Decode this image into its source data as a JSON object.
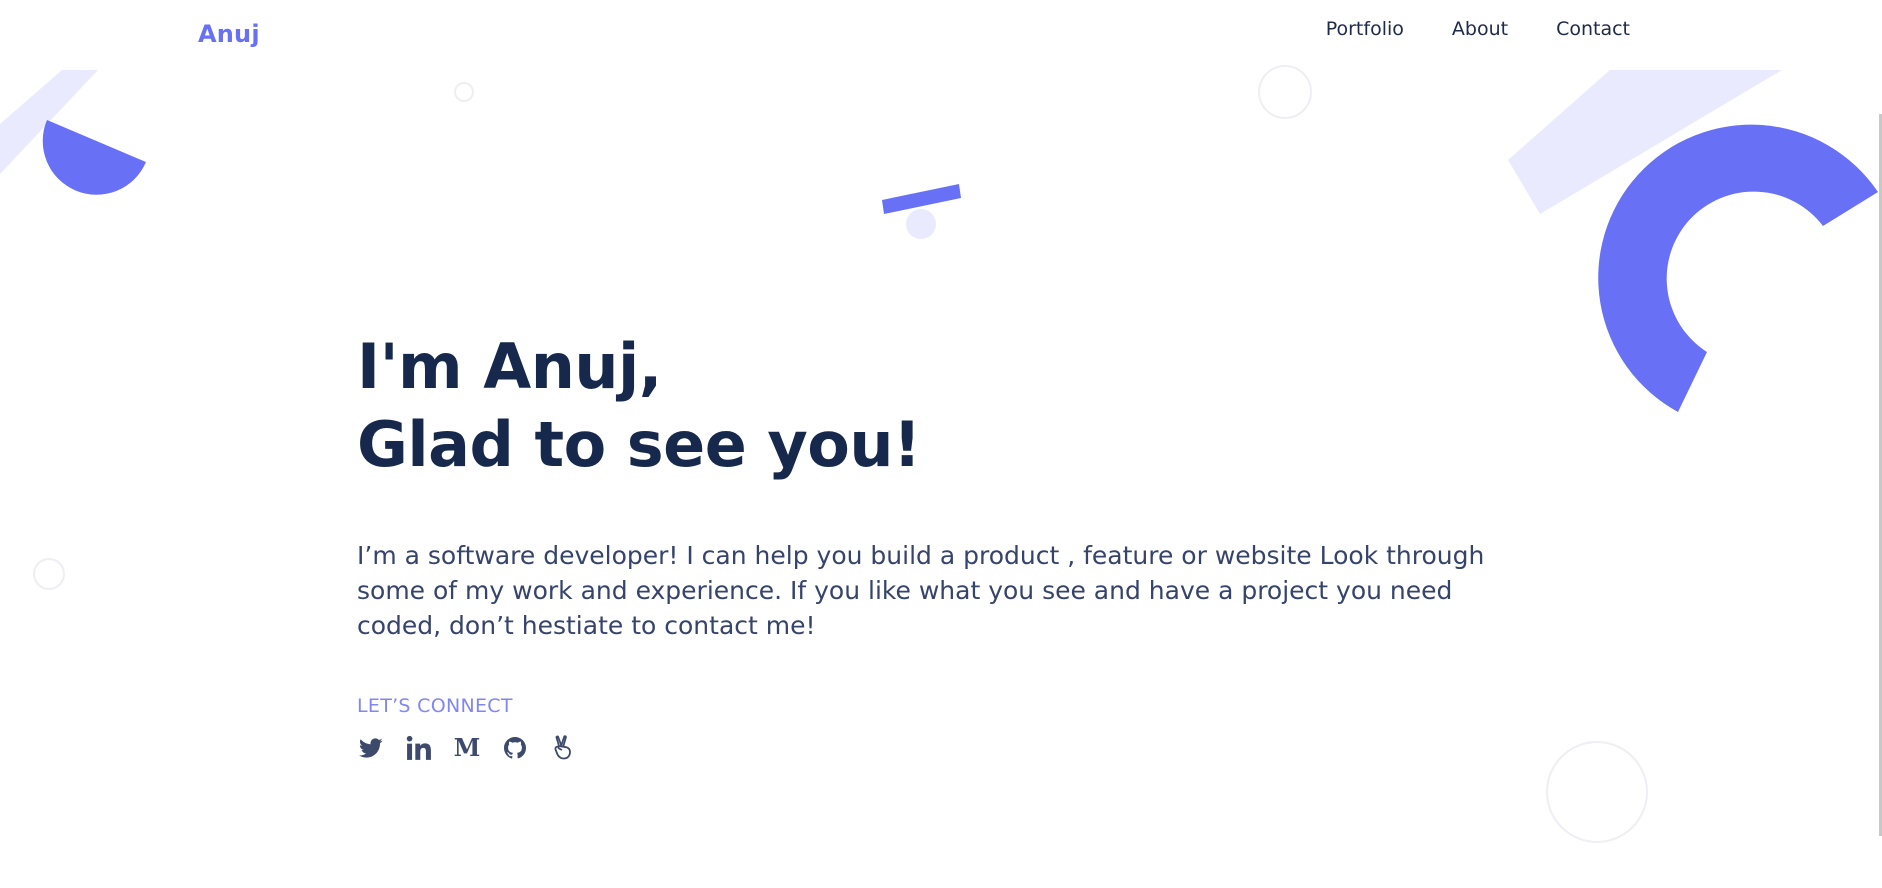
{
  "header": {
    "logo": "Anuj",
    "nav": [
      {
        "label": "Portfolio"
      },
      {
        "label": "About"
      },
      {
        "label": "Contact"
      }
    ]
  },
  "hero": {
    "title_line1": "I'm Anuj,",
    "title_line2": "Glad to see you!",
    "description": "I’m a software developer! I can help you build a product , feature or website Look through some of my work and experience. If you like what you see and have a project you need coded, don’t hestiate to contact me!",
    "connect_label": "LET’S CONNECT"
  },
  "socials": [
    {
      "icon": "twitter-icon"
    },
    {
      "icon": "linkedin-icon"
    },
    {
      "icon": "medium-icon"
    },
    {
      "icon": "github-icon"
    },
    {
      "icon": "angellist-icon"
    }
  ],
  "colors": {
    "accent": "#6871f5",
    "accent_light": "#e9eafd",
    "heading": "#16284b",
    "body_text": "#36436b",
    "icon": "#3d4a6b"
  }
}
